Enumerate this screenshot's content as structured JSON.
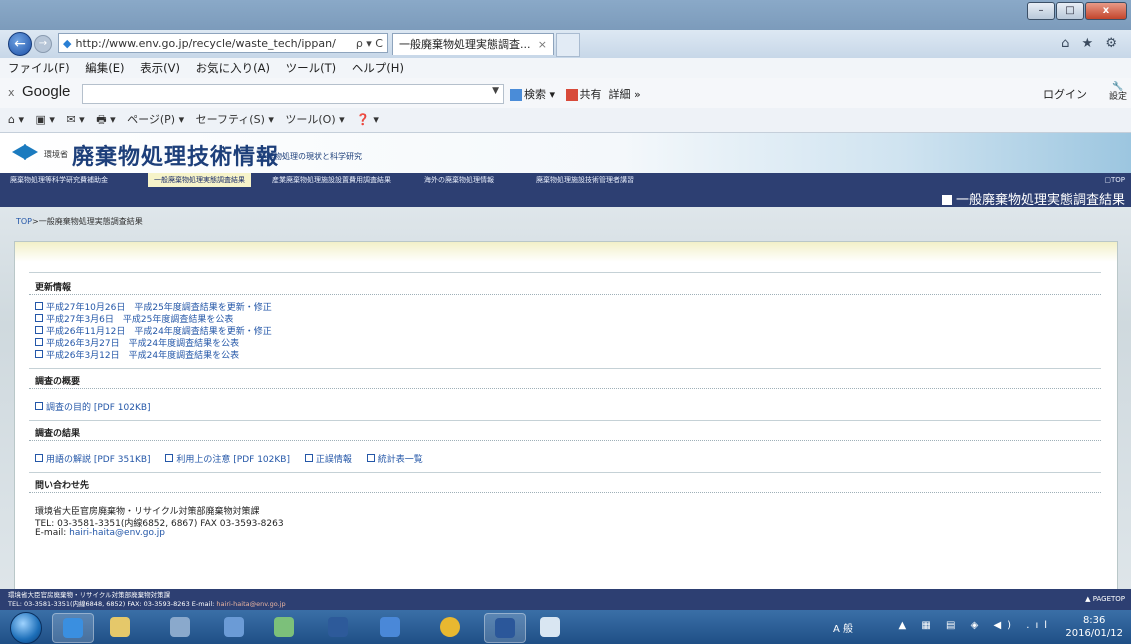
{
  "browser": {
    "window_buttons": {
      "minimize": "–",
      "maximize": "□",
      "close": "x"
    },
    "back_icon": "back-arrow-icon",
    "address": "http://www.env.go.jp/recycle/waste_tech/ippan/",
    "address_tools": "ρ ▾ C",
    "active_tab": "一般廃棄物処理実態調査...",
    "tab_close": "×",
    "nav_right_icons": "⌂ ★ ⚙",
    "menu": [
      "ファイル(F)",
      "編集(E)",
      "表示(V)",
      "お気に入り(A)",
      "ツール(T)",
      "ヘルプ(H)"
    ],
    "google": {
      "close": "x",
      "logo": "Google",
      "search_value": "",
      "search_label": "検索",
      "share_label": "共有",
      "more_label": "詳細 »",
      "login_label": "ログイン",
      "settings_label": "設定"
    },
    "command_bar": [
      "⌂ ▾",
      "▣ ▾",
      "✉ ▾",
      "🖶 ▾",
      "ページ(P) ▾",
      "セーフティ(S) ▾",
      "ツール(O) ▾",
      "❓ ▾"
    ]
  },
  "site": {
    "ministry": "環境省",
    "title": "廃棄物処理技術情報",
    "subtitle": "廃棄物処理の現状と科学研究",
    "nav": [
      "廃棄物処理等科学研究費補助金",
      "一般廃棄物処理実態調査結果",
      "産業廃棄物処理施設設置費用調査結果",
      "海外の廃棄物処理情報",
      "廃棄物処理施設技術管理者講習"
    ],
    "nav_active_index": 1,
    "top_link": "TOP",
    "page_heading": "一般廃棄物処理実態調査結果",
    "breadcrumb_top": "TOP",
    "breadcrumb_current": ">一般廃棄物処理実態調査結果"
  },
  "content": {
    "updates": {
      "heading": "更新情報",
      "items": [
        "平成27年10月26日　平成25年度調査結果を更新・修正",
        "平成27年3月6日　平成25年度調査結果を公表",
        "平成26年11月12日　平成24年度調査結果を更新・修正",
        "平成26年3月27日　平成24年度調査結果を公表",
        "平成26年3月12日　平成24年度調査結果を公表"
      ]
    },
    "overview": {
      "heading": "調査の概要",
      "items": [
        "調査の目的 [PDF 102KB]"
      ]
    },
    "results": {
      "heading": "調査の結果",
      "items": [
        "用語の解説 [PDF 351KB]",
        "利用上の注意 [PDF 102KB]",
        "正誤情報",
        "統計表一覧"
      ]
    },
    "contact": {
      "heading": "問い合わせ先",
      "org": "環境省大臣官房廃棄物・リサイクル対策部廃棄物対策課",
      "tel": "TEL: 03-3581-3351(内線6852, 6867)  FAX 03-3593-8263",
      "email_label": "E-mail:",
      "email": "hairi-haita@env.go.jp"
    }
  },
  "footer": {
    "org": "環境省大臣官房廃棄物・リサイクル対策部廃棄物対策課",
    "tel": "TEL: 03-3581-3351(内線6848, 6852)  FAX: 03-3593-8263  E-mail:",
    "email": "hairi-haita@env.go.jp",
    "pagetop": "▲ PAGETOP"
  },
  "taskbar": {
    "apps": [
      "ie-icon",
      "explorer-icon",
      "app-icon",
      "app-icon",
      "people-icon",
      "media-icon",
      "app-icon",
      "globe-icon",
      "word-icon",
      "paint-icon"
    ],
    "ime": "A 般",
    "tray_icons": "▲ ▦ ▤ ◈ ◀) .ıl",
    "time": "8:36",
    "date": "2016/01/12"
  },
  "colors": {
    "navy": "#2d3f72",
    "link": "#2457a8",
    "active_tab": "#f6f3c9"
  }
}
